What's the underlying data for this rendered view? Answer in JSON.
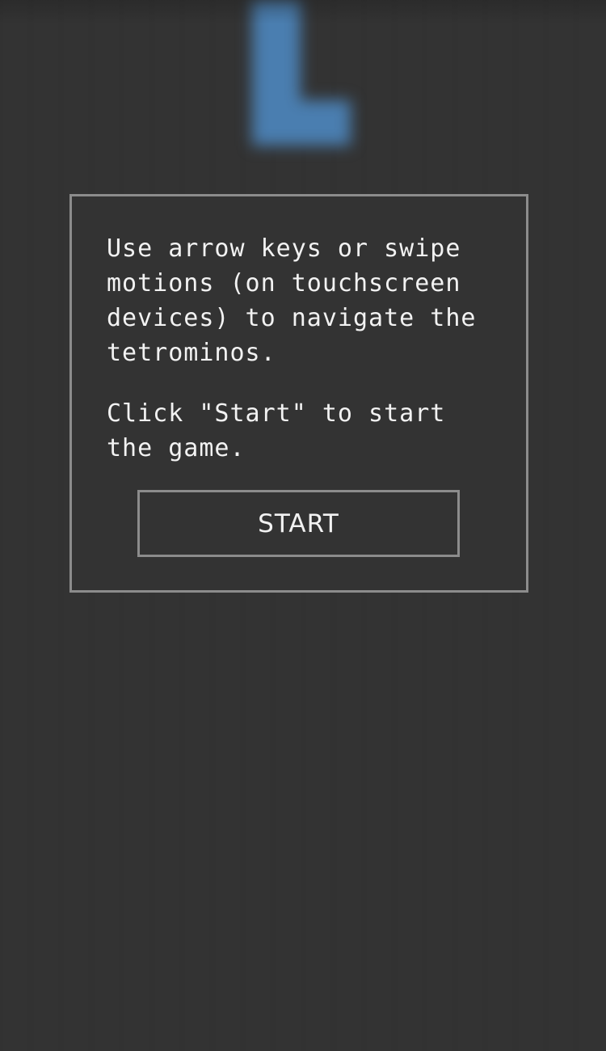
{
  "game": {
    "falling_piece": {
      "shape": "L",
      "color": "#4a7eb0"
    },
    "background_color": "#333333"
  },
  "dialog": {
    "instructions": "Use arrow keys or swipe motions (on touchscreen devices) to navigate the tetrominos.",
    "start_hint": "Click \"Start\" to start the game.",
    "start_button_label": "START",
    "border_color": "#8c8c8c"
  }
}
